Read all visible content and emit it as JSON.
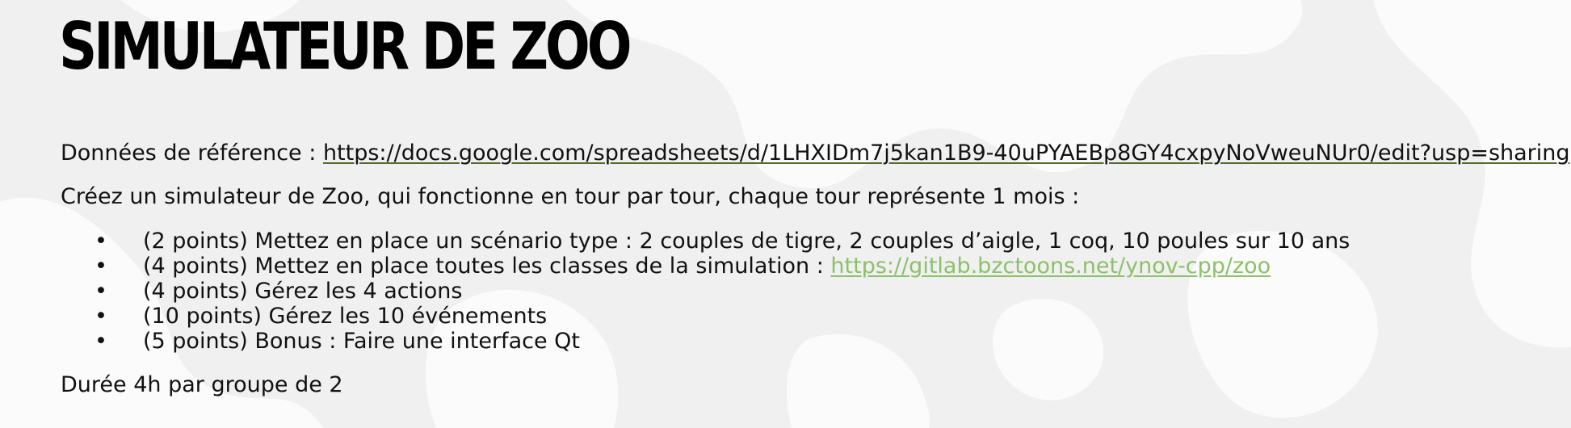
{
  "slide": {
    "title": "SIMULATEUR DE ZOO",
    "reference": {
      "label": "Données de référence : ",
      "link_text": "https://docs.google.com/spreadsheets/d/1LHXIDm7j5kan1B9-40uPYAEBp8GY4cxpyNoVweuNUr0/edit?usp=sharing"
    },
    "intro": "Créez un simulateur de Zoo, qui fonctionne en tour par tour, chaque tour représente 1 mois :",
    "bullet_symbol": "•",
    "bullets": [
      {
        "text": "(2 points) Mettez en place un scénario type : 2 couples de tigre, 2 couples d’aigle, 1 coq, 10 poules sur 10 ans"
      },
      {
        "text": "(4 points) Mettez en place toutes les classes de la simulation : ",
        "link": "https://gitlab.bzctoons.net/ynov-cpp/zoo"
      },
      {
        "text": "(4 points) Gérez les 4 actions"
      },
      {
        "text": "(10 points) Gérez les 10 événements"
      },
      {
        "text": "(5 points) Bonus : Faire une interface Qt"
      }
    ],
    "duration": "Durée 4h par groupe de 2"
  },
  "colors": {
    "background": "#f0f0f0",
    "blob": "#fbfbfb",
    "title": "#000000",
    "text": "#111111",
    "reference_link_underline": "#556b2f",
    "gitlab_link": "#8dc06a"
  }
}
